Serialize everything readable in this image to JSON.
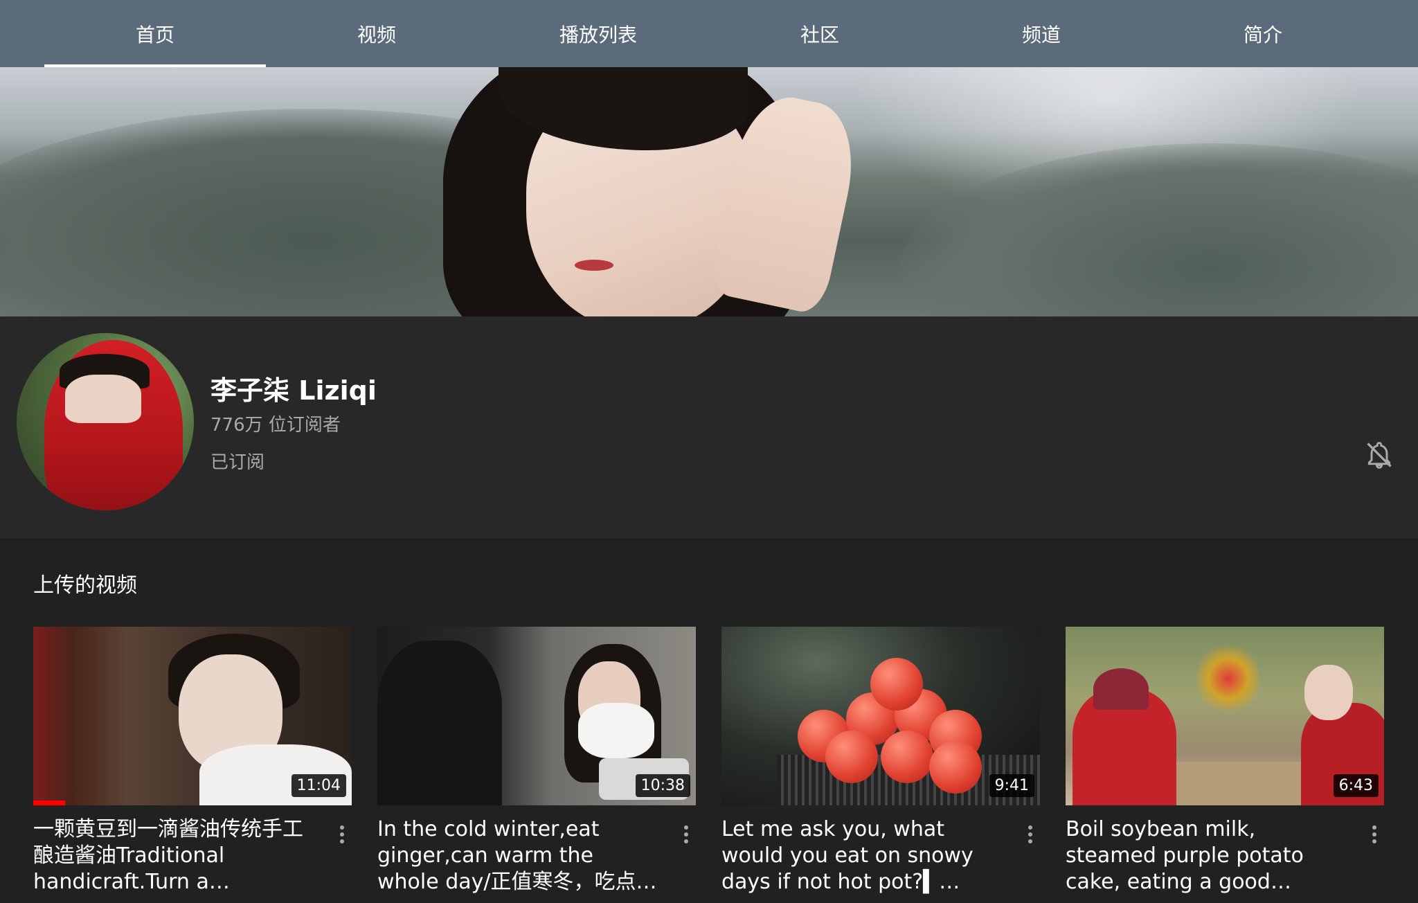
{
  "tabs": [
    {
      "label": "首页",
      "active": true
    },
    {
      "label": "视频",
      "active": false
    },
    {
      "label": "播放列表",
      "active": false
    },
    {
      "label": "社区",
      "active": false
    },
    {
      "label": "频道",
      "active": false
    },
    {
      "label": "简介",
      "active": false
    }
  ],
  "channel": {
    "name": "李子柒 Liziqi",
    "subscribers": "776万 位订阅者",
    "subscribe_status": "已订阅",
    "bell_icon": "notifications-off-icon"
  },
  "uploads": {
    "section_title": "上传的视频",
    "videos": [
      {
        "title": "一颗黄豆到一滴酱油传统手工酿造酱油Traditional handicraft.Turn a soybean…",
        "duration": "11:04",
        "watched_fraction": 0.1
      },
      {
        "title": "In the cold winter,eat ginger,can warm the whole day/正值寒冬，吃点生姜…",
        "duration": "10:38"
      },
      {
        "title": "Let me ask you, what would you eat on snowy days if not hot pot?▍ Snowy days go…",
        "duration": "9:41"
      },
      {
        "title": "Boil soybean milk, steamed purple potato cake, eating a good breakfast is a must|L…",
        "duration": "6:43"
      }
    ]
  },
  "colors": {
    "tab_bar": "#5c6b7b",
    "page_bg": "#212121",
    "channel_bg": "#282828",
    "progress": "#ff0000"
  }
}
